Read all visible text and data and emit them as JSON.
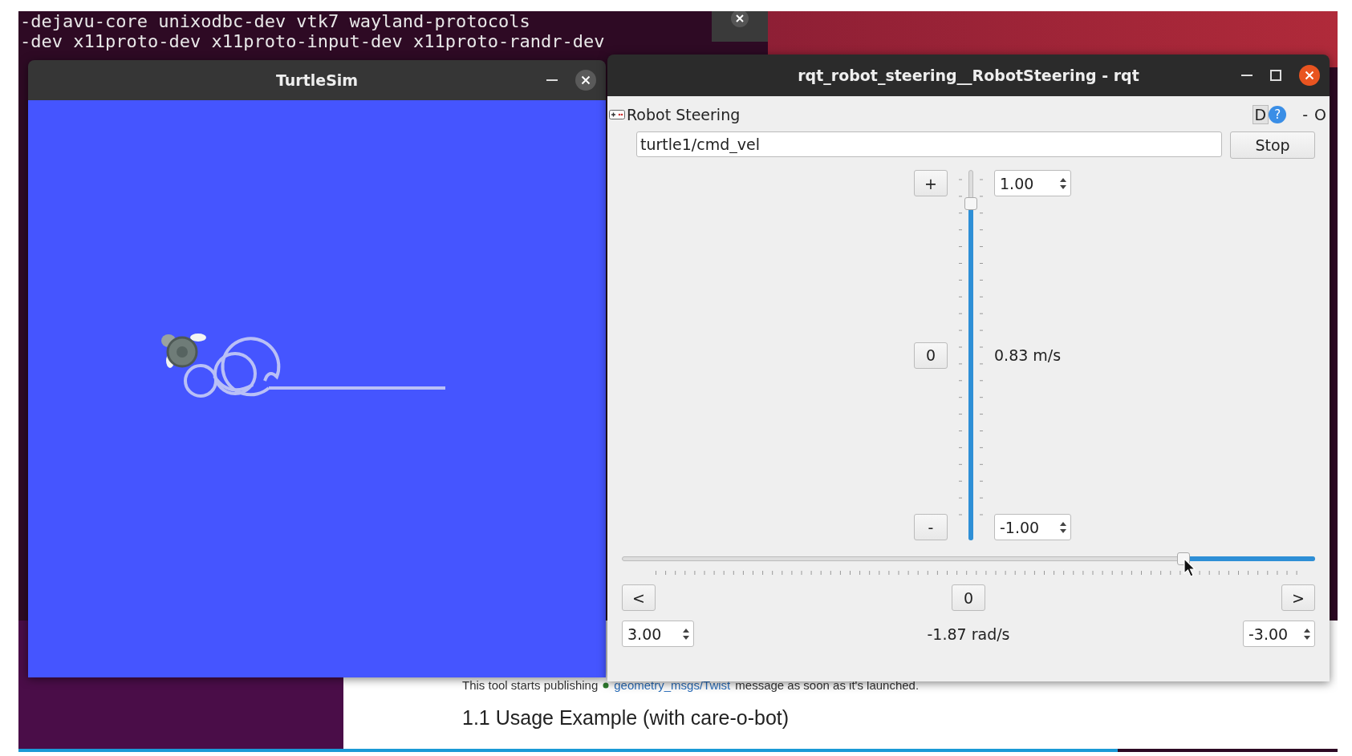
{
  "terminal": {
    "lines": [
      "-dejavu-core unixodbc-dev vtk7 wayland-protocols",
      "-dev x11proto-dev x11proto-input-dev x11proto-randr-dev"
    ]
  },
  "turtlesim_window": {
    "title": "TurtleSim"
  },
  "steering_window": {
    "title": "rqt_robot_steering__RobotSteering - rqt",
    "plugin_title": "Robot Steering",
    "plugin_controls": [
      {
        "kind": "boxed",
        "label": "D"
      },
      {
        "kind": "help",
        "label": "?"
      },
      {
        "kind": "plain",
        "label": "-"
      },
      {
        "kind": "plain",
        "label": "O"
      }
    ],
    "topic": {
      "value": "turtle1/cmd_vel"
    },
    "stop_button": "Stop",
    "linear": {
      "increase_button": "+",
      "reset_button": "0",
      "decrease_button": "-",
      "max": "1.00",
      "min": "-1.00",
      "reading": "0.83 m/s",
      "level": 0.91
    },
    "angular": {
      "left_button": "<",
      "reset_button": "0",
      "right_button": ">",
      "max": "3.00",
      "min": "-3.00",
      "reading": "-1.87 rad/s",
      "level": 0.81
    }
  },
  "browser": {
    "sentence_start": "This tool starts publishing",
    "link": "geometry_msgs/Twist",
    "sentence_end": "message as soon as it's launched.",
    "heading": "1.1 Usage Example (with care-o-bot)"
  }
}
